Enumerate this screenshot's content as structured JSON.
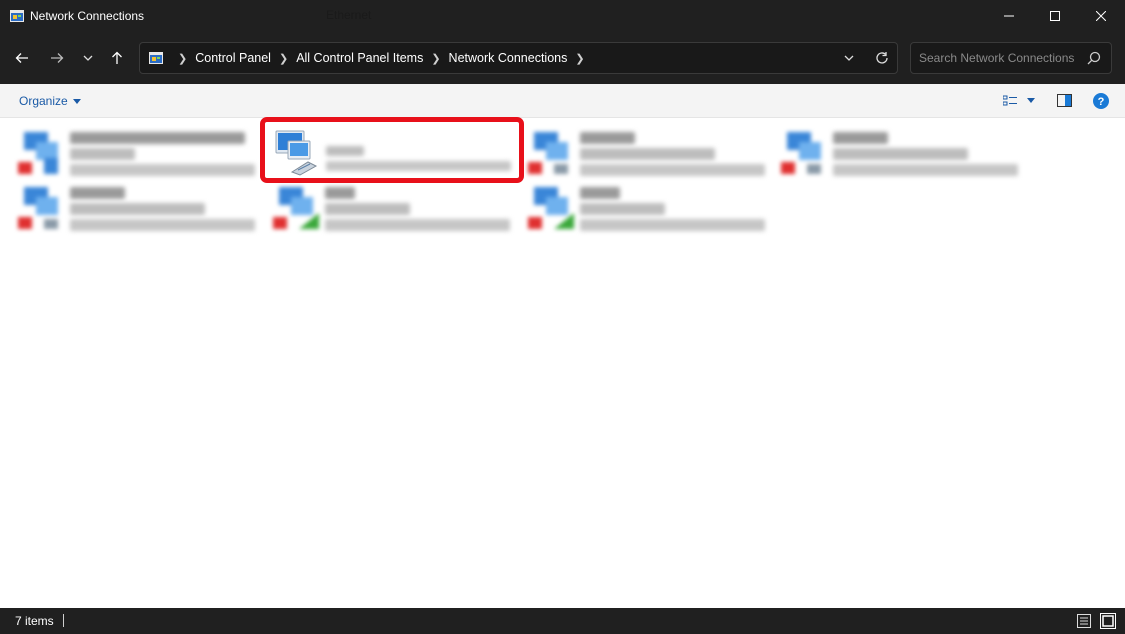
{
  "window": {
    "title": "Network Connections",
    "icons": {
      "app": "control-panel-icon",
      "minimize": "minimize-icon",
      "maximize": "maximize-icon",
      "close": "close-icon"
    }
  },
  "nav": {
    "icons": [
      "back-arrow-icon",
      "forward-arrow-icon",
      "recent-locations-chevron-icon",
      "up-arrow-icon"
    ],
    "breadcrumbs": [
      "Control Panel",
      "All Control Panel Items",
      "Network Connections"
    ],
    "address_icons": [
      "control-panel-icon",
      "chevron-down-icon",
      "refresh-icon"
    ],
    "search_placeholder": "Search Network Connections"
  },
  "command_bar": {
    "organize_label": "Organize",
    "icons": [
      "view-options-icon",
      "preview-pane-icon",
      "help-icon"
    ]
  },
  "items": [
    {
      "name": "Ethernet",
      "highlighted": true,
      "icon": "ethernet-adapter-icon"
    }
  ],
  "colors": {
    "accent": "#1a5aa6",
    "highlight_border": "#e8101a",
    "titlebar": "#202020",
    "content_bg": "#ffffff"
  },
  "status": {
    "item_count": "7 items",
    "icons": [
      "details-view-icon",
      "large-icons-view-icon"
    ]
  }
}
